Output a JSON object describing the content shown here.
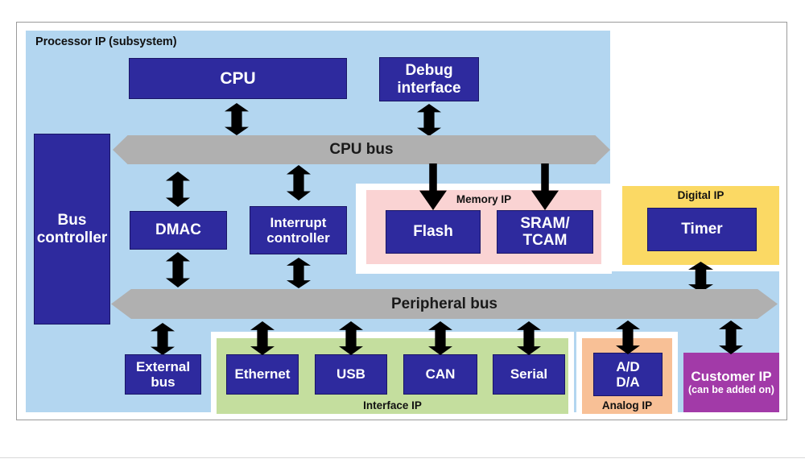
{
  "diagram": {
    "title": "Processor IP (subsystem)",
    "processor_ip": {
      "label": "Processor IP (subsystem)",
      "bus_controller": "Bus\ncontroller",
      "bus_controller_line1": "Bus",
      "bus_controller_line2": "controller",
      "cpu": "CPU",
      "debug_interface_line1": "Debug",
      "debug_interface_line2": "interface",
      "cpu_bus": "CPU bus",
      "dmac": "DMAC",
      "interrupt_controller_line1": "Interrupt",
      "interrupt_controller_line2": "controller",
      "peripheral_bus": "Peripheral bus",
      "external_bus_line1": "External",
      "external_bus_line2": "bus"
    },
    "memory_ip": {
      "label": "Memory IP",
      "blocks": [
        {
          "line1": "Flash",
          "line2": ""
        },
        {
          "line1": "SRAM/",
          "line2": "TCAM"
        }
      ]
    },
    "digital_ip": {
      "label": "Digital IP",
      "blocks": [
        {
          "line1": "Timer"
        }
      ]
    },
    "interface_ip": {
      "label": "Interface IP",
      "blocks": [
        {
          "line1": "Ethernet"
        },
        {
          "line1": "USB"
        },
        {
          "line1": "CAN"
        },
        {
          "line1": "Serial"
        }
      ]
    },
    "analog_ip": {
      "label": "Analog IP",
      "blocks": [
        {
          "line1": "A/D",
          "line2": "D/A"
        }
      ]
    },
    "customer_ip": {
      "title": "Customer IP",
      "subtitle": "(can be added on)"
    },
    "colors": {
      "processor_panel": "#b3d6f0",
      "block_fill": "#2e2a9e",
      "block_text": "#ffffff",
      "bus_fill": "#b0b0b0",
      "memory_panel": "#fad3d3",
      "digital_panel": "#fbd964",
      "interface_panel": "#c4de9e",
      "analog_panel": "#f8c096",
      "customer_panel": "#a23aa8",
      "arrow": "#000000"
    }
  }
}
